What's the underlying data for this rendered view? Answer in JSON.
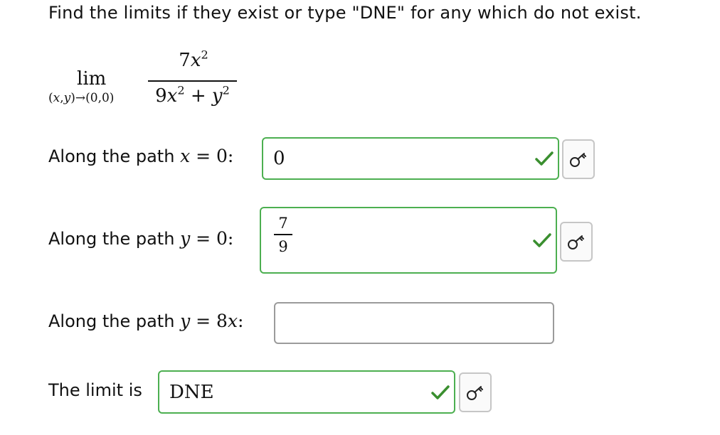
{
  "instruction": "Find the limits if they exist or type \"DNE\" for any which do not exist.",
  "limit": {
    "lim_word": "lim",
    "subscript": "(x,y)→(0,0)",
    "numerator": "7x²",
    "denominator": "9x² + y²"
  },
  "rows": [
    {
      "label_prefix": "Along the path",
      "path_math": "x = 0:",
      "answer": "0",
      "status": "correct"
    },
    {
      "label_prefix": "Along the path",
      "path_math": "y = 0:",
      "answer_numerator": "7",
      "answer_denominator": "9",
      "status": "correct"
    },
    {
      "label_prefix": "Along the path",
      "path_math": "y = 8x:",
      "answer": "",
      "status": "empty"
    },
    {
      "label_prefix": "The limit is",
      "answer": "DNE",
      "status": "correct"
    }
  ],
  "icons": {
    "check": "check-icon",
    "key": "key-icon"
  },
  "colors": {
    "correct_border": "#4caf50",
    "check": "#3a8f2f",
    "empty_border": "#9b9b9b"
  }
}
